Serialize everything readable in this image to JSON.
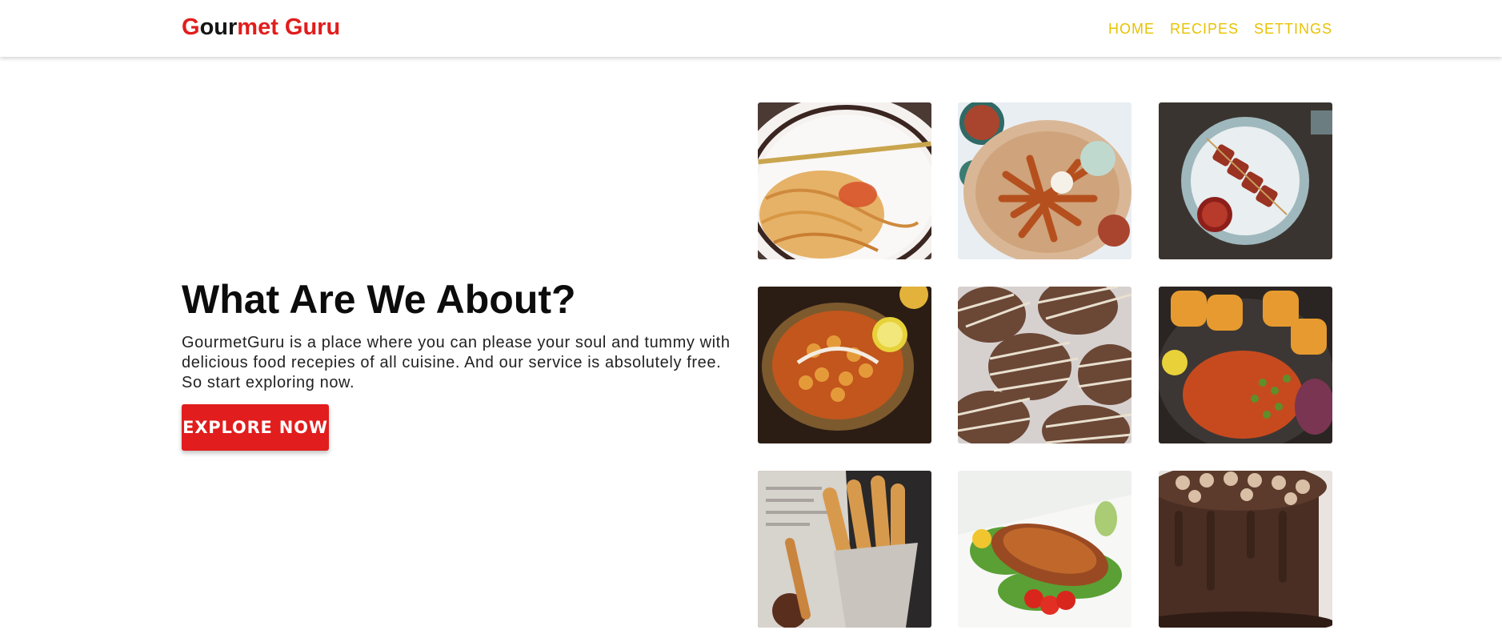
{
  "header": {
    "logo": {
      "part1": "G",
      "part2": "our",
      "part3": "met Guru"
    },
    "nav": [
      {
        "label": "HOME"
      },
      {
        "label": "RECIPES"
      },
      {
        "label": "SETTINGS"
      }
    ]
  },
  "hero": {
    "title": "What Are We About?",
    "description": "GourmetGuru is a place where you can please your soul and tummy with delicious food recepies of all cuisine. And our service is absolutely free. So start exploring now.",
    "button_label": "EXPLORE NOW"
  },
  "gallery": {
    "images": [
      {
        "icon": "spaghetti-plate-image"
      },
      {
        "icon": "sweet-potato-fries-image"
      },
      {
        "icon": "kebab-skewers-image"
      },
      {
        "icon": "curry-bowl-image"
      },
      {
        "icon": "chocolate-cookies-image"
      },
      {
        "icon": "pav-bhaji-image"
      },
      {
        "icon": "churros-image"
      },
      {
        "icon": "grilled-salmon-image"
      },
      {
        "icon": "chocolate-cake-image"
      }
    ]
  },
  "colors": {
    "brand_red": "#e11d1d",
    "nav_yellow": "#e8c200"
  }
}
